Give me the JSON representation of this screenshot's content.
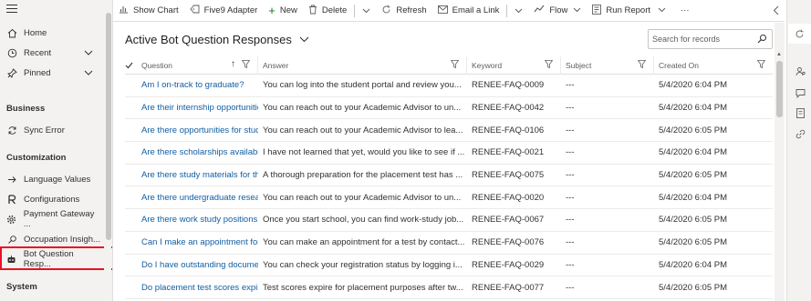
{
  "sidebar": {
    "items_top": [
      {
        "label": "Home",
        "icon": "home-icon"
      },
      {
        "label": "Recent",
        "icon": "clock-icon",
        "chevron": true
      },
      {
        "label": "Pinned",
        "icon": "pin-icon",
        "chevron": true
      }
    ],
    "section_business": "Business",
    "business_items": [
      {
        "label": "Sync Error",
        "icon": "sync-icon"
      }
    ],
    "section_customization": "Customization",
    "customization_items": [
      {
        "label": "Language Values",
        "icon": "arrow-icon"
      },
      {
        "label": "Configurations",
        "icon": "config-icon"
      },
      {
        "label": "Payment Gateway ...",
        "icon": "gear-icon"
      },
      {
        "label": "Occupation Insigh...",
        "icon": "search-icon"
      },
      {
        "label": "Bot Question Resp...",
        "icon": "bot-icon",
        "highlighted": true
      }
    ],
    "section_system": "System"
  },
  "commandbar": {
    "show_chart": "Show Chart",
    "adapter": "Five9 Adapter",
    "new": "New",
    "delete": "Delete",
    "refresh": "Refresh",
    "email_link": "Email a Link",
    "flow": "Flow",
    "run_report": "Run Report",
    "more": "···"
  },
  "view": {
    "title": "Active Bot Question Responses",
    "search_placeholder": "Search for records"
  },
  "grid": {
    "columns": [
      "Question",
      "Answer",
      "Keyword",
      "Subject",
      "Created On"
    ],
    "rows": [
      [
        "Am I on-track to graduate?",
        "You can log into the student portal and review you...",
        "RENEE-FAQ-0009",
        "---",
        "5/4/2020 6:04 PM"
      ],
      [
        "Are their internship opportunities",
        "You can reach out to your Academic Advisor to un...",
        "RENEE-FAQ-0042",
        "---",
        "5/4/2020 6:04 PM"
      ],
      [
        "Are there opportunities for study a",
        "You can reach out to your Academic Advisor to lea...",
        "RENEE-FAQ-0106",
        "---",
        "5/4/2020 6:05 PM"
      ],
      [
        "Are there scholarships available sp",
        "I have not learned that yet, would you like to see if ...",
        "RENEE-FAQ-0021",
        "---",
        "5/4/2020 6:04 PM"
      ],
      [
        "Are there study materials for the p",
        "A thorough preparation for the placement test has ...",
        "RENEE-FAQ-0075",
        "---",
        "5/4/2020 6:05 PM"
      ],
      [
        "Are there undergraduate research",
        "You can reach out to your Academic Advisor to un...",
        "RENEE-FAQ-0020",
        "---",
        "5/4/2020 6:04 PM"
      ],
      [
        "Are there work study positions ava",
        "Once you start school, you can find work-study job...",
        "RENEE-FAQ-0067",
        "---",
        "5/4/2020 6:05 PM"
      ],
      [
        "Can I make an appointment for a t",
        "You can make an appointment for a test by contact...",
        "RENEE-FAQ-0076",
        "---",
        "5/4/2020 6:05 PM"
      ],
      [
        "Do I have outstanding documents",
        "You can check your registration status by logging i...",
        "RENEE-FAQ-0029",
        "---",
        "5/4/2020 6:04 PM"
      ],
      [
        "Do placement test scores expire?",
        "Test scores expire for placement purposes after tw...",
        "RENEE-FAQ-0077",
        "---",
        "5/4/2020 6:05 PM"
      ]
    ]
  }
}
